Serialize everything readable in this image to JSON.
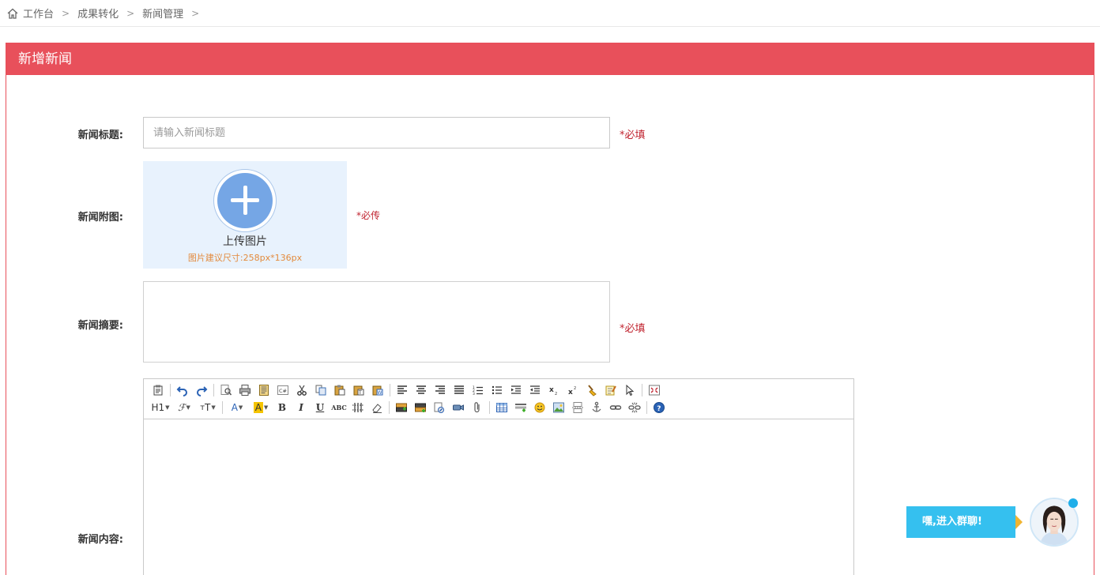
{
  "breadcrumb": {
    "items": [
      "工作台",
      "成果转化",
      "新闻管理"
    ],
    "separator": ">"
  },
  "panel": {
    "title": "新增新闻"
  },
  "form": {
    "title_label": "新闻标题:",
    "title_placeholder": "请输入新闻标题",
    "title_value": "",
    "title_required": "*必填",
    "image_label": "新闻附图:",
    "upload_text": "上传图片",
    "upload_hint": "图片建议尺寸:258px*136px",
    "image_required": "*必传",
    "summary_label": "新闻摘要:",
    "summary_value": "",
    "summary_required": "*必填",
    "content_label": "新闻内容:"
  },
  "editor": {
    "heading_label": "H1",
    "bold_label": "B",
    "italic_label": "I",
    "underline_label": "U",
    "strike_label": "ABC",
    "font_color_label": "A",
    "bg_color_label": "A"
  },
  "chat": {
    "button_label": "嘿,进入群聊!"
  },
  "colors": {
    "accent": "#e8505b",
    "required": "#c0232f",
    "chat": "#35c0ef",
    "upload_bg": "#e8f2fd",
    "upload_circle": "#75a6e5"
  }
}
